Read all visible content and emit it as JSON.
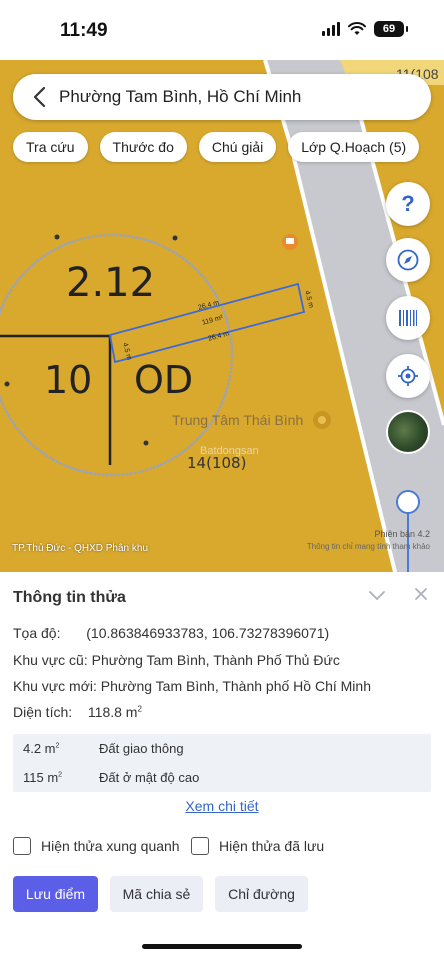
{
  "status": {
    "time": "11:49",
    "battery": "69"
  },
  "search": {
    "text": "Phường Tam Bình, Hồ Chí Minh"
  },
  "chips": [
    {
      "label": "Tra cứu"
    },
    {
      "label": "Thước đo"
    },
    {
      "label": "Chú giải"
    },
    {
      "label": "Lớp Q.Hoạch (5)"
    }
  ],
  "map": {
    "parcel_code": "2.12",
    "block_number": "10",
    "zone_code": "OD",
    "top_edge": "26.4 m",
    "bottom_edge": "26.4 m",
    "left_edge": "4.5 m",
    "right_edge": "4.5 m",
    "area_label": "119 m²",
    "poi_name": "Trung Tâm Thái Bình",
    "lot_label": "14(108)",
    "corner_label": "11(108",
    "watermark": "Batdongsan",
    "layer_caption": "TP.Thủ Đức - QHXD Phân khu",
    "version": "Phiên bản 4.2",
    "attribution": "Thông tin chỉ mang tính tham khảo",
    "colors": {
      "residential": "#d9a92e",
      "road": "#c7c9cf",
      "parcel_outline": "#3c6bd8"
    }
  },
  "fab_icons": [
    "help-icon",
    "compass-icon",
    "barcode-icon",
    "locate-icon"
  ],
  "sheet": {
    "title": "Thông tin thửa",
    "coords_label": "Tọa độ:",
    "coords_value": "(10.863846933783, 106.73278396071)",
    "old_area_label": "Khu vực cũ:",
    "old_area_value": "Phường Tam Bình, Thành Phố Thủ Đức",
    "new_area_label": "Khu vực mới:",
    "new_area_value": "Phường Tam Bình, Thành phố Hồ Chí Minh",
    "size_label": "Diện tích:",
    "size_value": "118.8 m",
    "size_unit_sup": "2",
    "land_uses": [
      {
        "area": "4.2 m",
        "sup": "2",
        "type": "Đất giao thông"
      },
      {
        "area": "115 m",
        "sup": "2",
        "type": "Đất ở mật độ cao"
      }
    ],
    "detail_link": "Xem chi tiết",
    "show_nearby": "Hiện thửa xung quanh",
    "show_saved": "Hiện thửa đã lưu",
    "save_button": "Lưu điểm",
    "share_button": "Mã chia sẻ",
    "directions_button": "Chỉ đường"
  }
}
